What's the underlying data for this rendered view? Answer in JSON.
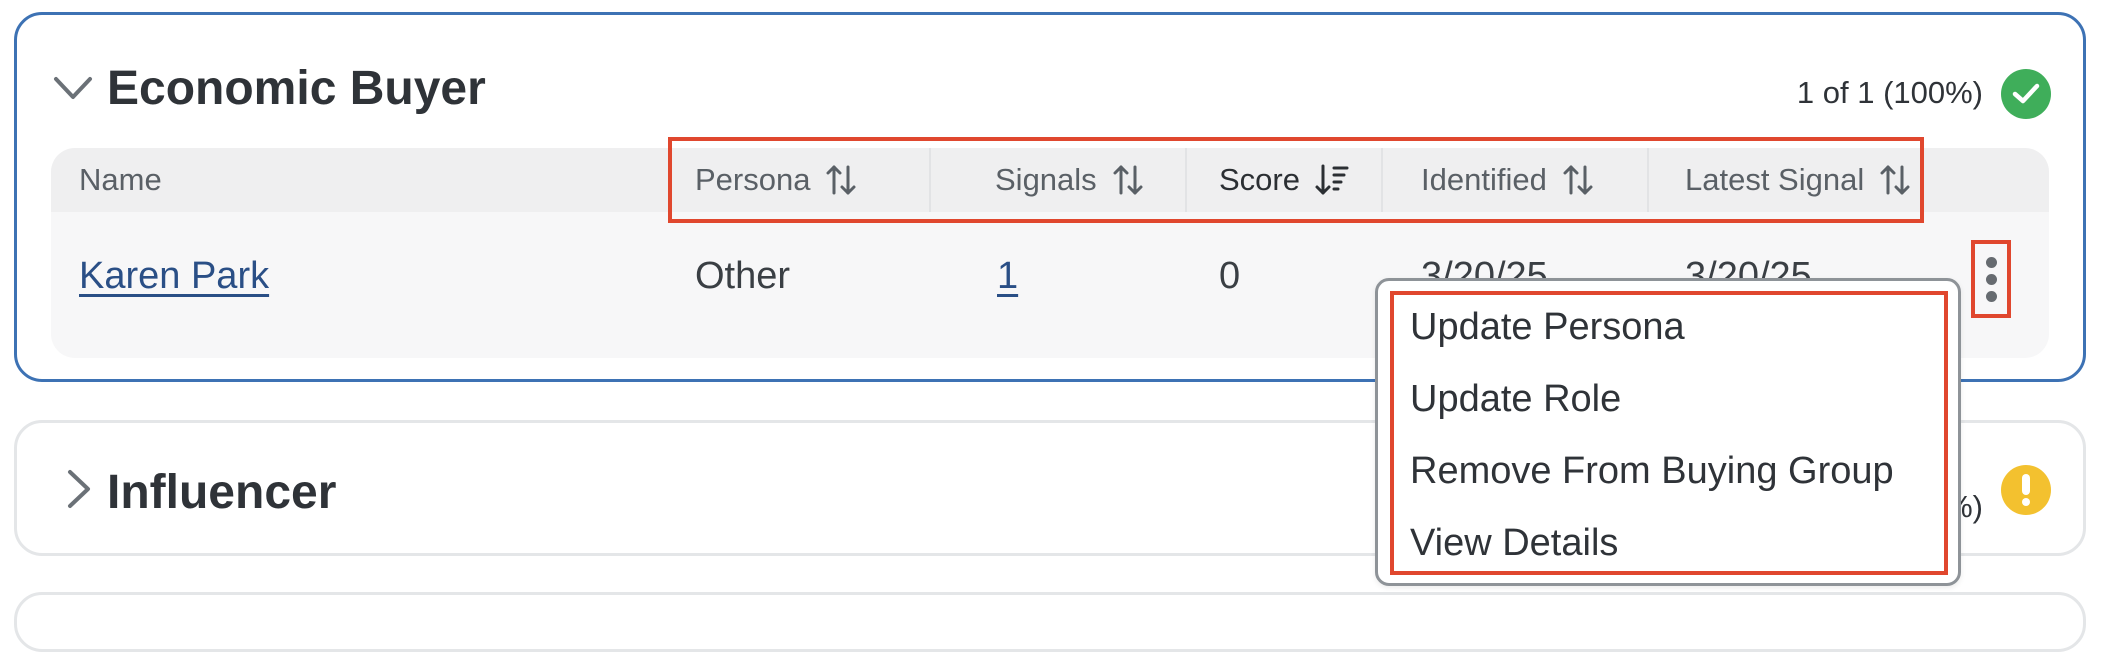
{
  "economic_buyer": {
    "title": "Economic Buyer",
    "count": "1 of 1 (100%)",
    "status_color": "#3fae5a",
    "columns": [
      "Name",
      "Persona",
      "Signals",
      "Score",
      "Identified",
      "Latest Signal"
    ],
    "rows": [
      {
        "name": "Karen Park",
        "persona": "Other",
        "signals": "1",
        "score": "0",
        "identified": "3/20/25",
        "latest_signal": "3/20/25"
      }
    ]
  },
  "influencer": {
    "title": "Influencer",
    "count_partial": "%)",
    "status_color": "#f3c12f"
  },
  "context_menu": {
    "items": [
      "Update Persona",
      "Update Role",
      "Remove From Buying Group",
      "View Details"
    ]
  },
  "colors": {
    "accent_border": "#3d72b4",
    "highlight": "#e0472e",
    "link": "#2a4f86"
  }
}
